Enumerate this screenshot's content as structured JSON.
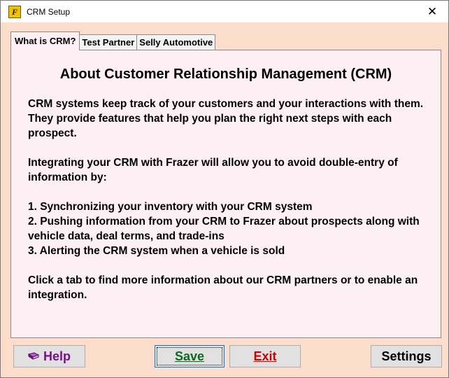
{
  "window": {
    "title": "CRM Setup",
    "app_icon_text": "F",
    "close_glyph": "✕"
  },
  "tabs": [
    {
      "label": "What is CRM?",
      "active": true
    },
    {
      "label": "Test Partner",
      "active": false
    },
    {
      "label": "Selly Automotive",
      "active": false
    }
  ],
  "content": {
    "heading": "About Customer Relationship Management (CRM)",
    "intro": "CRM systems keep track of your customers and your interactions with them. They provide features that help you plan the right next steps with each prospect.",
    "integration": "Integrating your CRM with Frazer will allow you to avoid double-entry of information by:",
    "list": [
      "1. Synchronizing your inventory with your CRM system",
      "2. Pushing information from your CRM to Frazer about prospects along with vehicle data, deal terms, and trade-ins",
      "3. Alerting the CRM system when a vehicle is sold"
    ],
    "closing": "Click a tab to find more information about our CRM partners or to enable an integration."
  },
  "buttons": {
    "help": "Help",
    "save": "Save",
    "exit": "Exit",
    "settings": "Settings"
  },
  "colors": {
    "window_bg": "#fcdccb",
    "panel_bg": "#fcf0f5",
    "help": "#7a0e8c",
    "save": "#0b6a1e",
    "exit": "#d00000"
  },
  "icons": {
    "help": "book-icon",
    "close": "close-icon",
    "app": "app-icon"
  }
}
